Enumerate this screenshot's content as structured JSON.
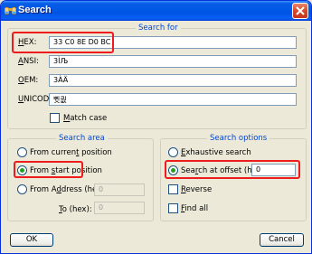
{
  "window": {
    "title": "Search",
    "close_icon": "close-icon",
    "app_icon": "search-binoculars-icon"
  },
  "search_for": {
    "legend": "Search for",
    "hex": {
      "label": "HEX:",
      "value": "33 C0 8E D0 BC"
    },
    "ansi": {
      "label": "ANSI:",
      "value": "3ÌЉ"
    },
    "oem": {
      "label": "OEM:",
      "value": "3ÀÄ"
    },
    "unicode": {
      "label": "UNICODE:",
      "value": "쀳퀎"
    },
    "match_case": {
      "label": "Match case",
      "checked": false
    }
  },
  "search_area": {
    "legend": "Search area",
    "from_current": "From current position",
    "from_start": "From start position",
    "from_address": "From Address (hex):",
    "from_address_value": "0",
    "to_label": "To (hex):",
    "to_value": "0",
    "selected": "from_start"
  },
  "search_options": {
    "legend": "Search options",
    "exhaustive": "Exhaustive search",
    "at_offset": "Search at offset (hex):",
    "offset_value": "0",
    "reverse": "Reverse",
    "find_all": "Find all",
    "selected": "at_offset"
  },
  "buttons": {
    "ok": "OK",
    "cancel": "Cancel"
  },
  "colors": {
    "highlight": "#ee1c1c",
    "legend": "#0046d5",
    "title_bar": "#0054e3"
  }
}
